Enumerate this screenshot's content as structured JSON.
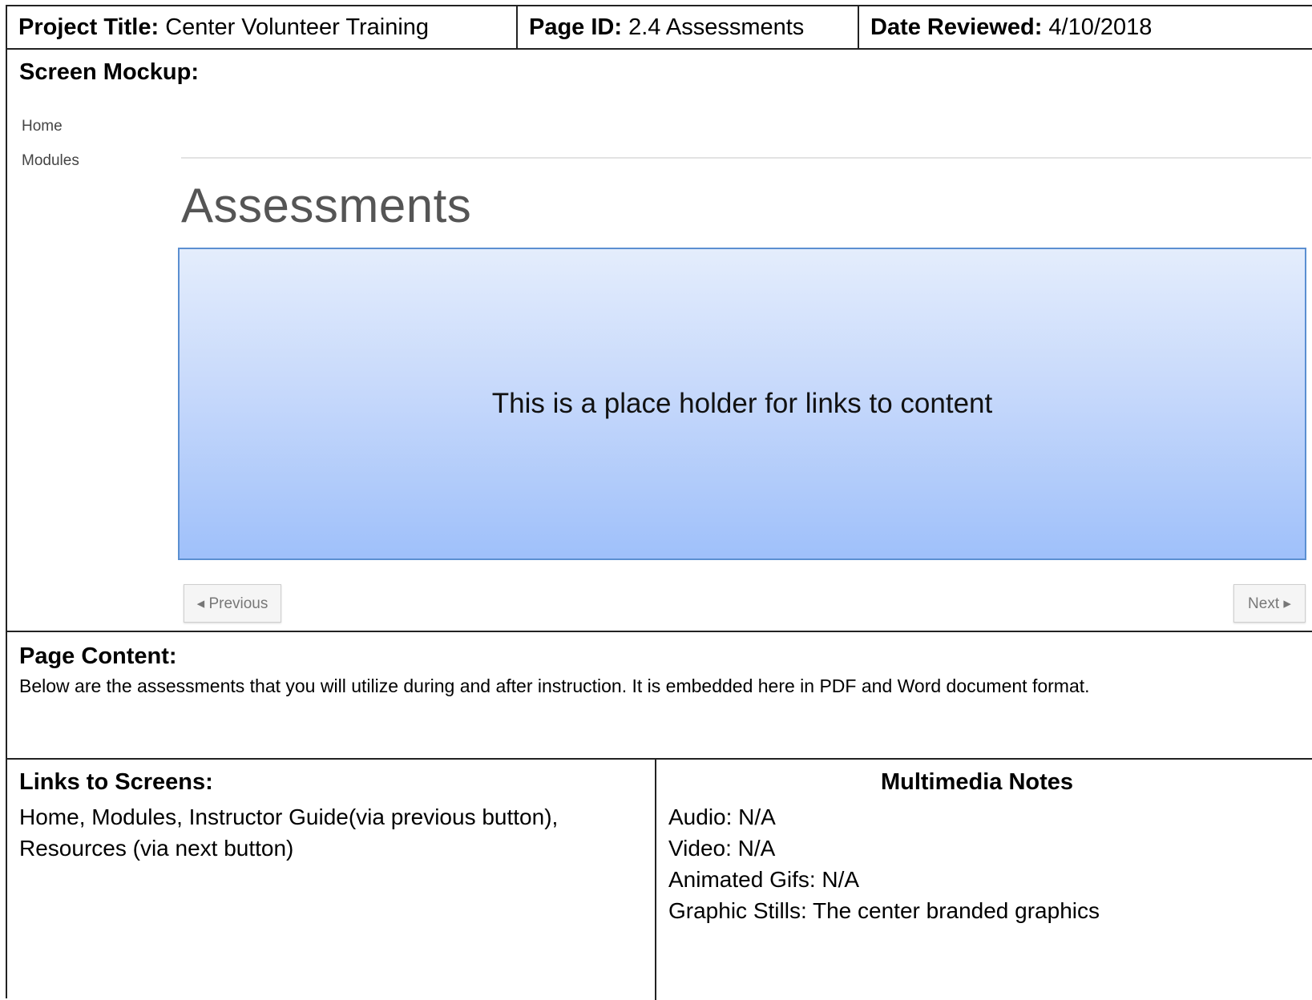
{
  "header": {
    "project_title_label": "Project Title:",
    "project_title_value": "Center Volunteer Training",
    "page_id_label": "Page ID:",
    "page_id_value": "2.4 Assessments",
    "date_reviewed_label": "Date Reviewed:",
    "date_reviewed_value": "4/10/2018"
  },
  "mockup": {
    "section_label": "Screen Mockup:",
    "nav_home": "Home",
    "nav_modules": "Modules",
    "page_title": "Assessments",
    "placeholder_text": "This is a place holder for links to content",
    "previous_button": "◂ Previous",
    "next_button": "Next ▸"
  },
  "page_content": {
    "section_label": "Page Content:",
    "text": "Below are the assessments that you will utilize during and after instruction. It is embedded here in PDF and Word document format."
  },
  "links": {
    "section_label": "Links to Screens:",
    "text": "Home, Modules, Instructor Guide(via previous button), Resources (via next button)"
  },
  "multimedia": {
    "title": "Multimedia Notes",
    "audio": "Audio: N/A",
    "video": "Video: N/A",
    "animated_gifs": "Animated Gifs: N/A",
    "graphic_stills": "Graphic Stills: The center branded graphics"
  },
  "colors": {
    "placeholder_top": "#e4edfc",
    "placeholder_bottom": "#9fc0fa",
    "placeholder_border": "#5b8fd1"
  }
}
